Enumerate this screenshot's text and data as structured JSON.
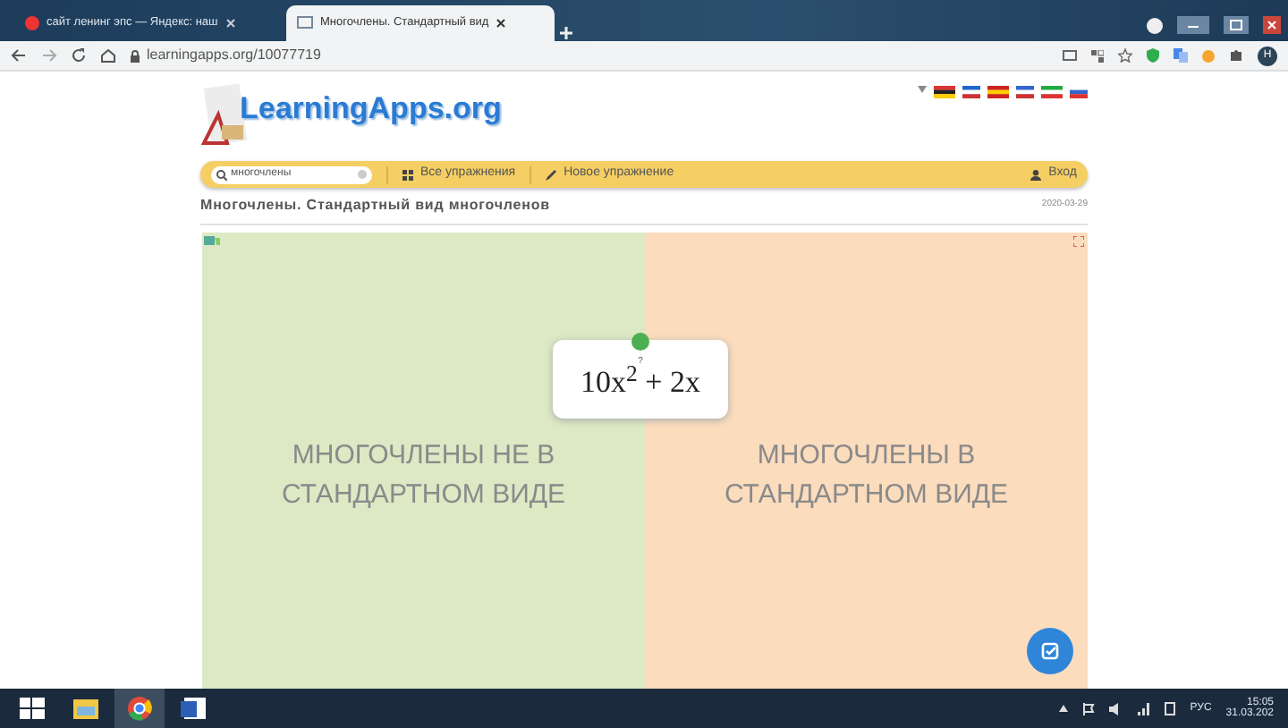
{
  "browser": {
    "tabs": [
      {
        "title": "сайт ленинг эпс — Яндекс: наш",
        "selected": false
      },
      {
        "title": "Многочлены. Стандартный вид",
        "selected": true
      }
    ],
    "url": "learningapps.org/10077719",
    "profile": "Н"
  },
  "site": {
    "logo": "LearningApps.org",
    "search": {
      "value": "многочлены"
    },
    "menu": [
      {
        "label": "Все упражнения",
        "kind": "grid"
      },
      {
        "label": "Новое упражнение",
        "kind": "pencil"
      }
    ],
    "login": "Вход"
  },
  "exercise": {
    "title": "Многочлены. Стандартный вид многочленов",
    "date": "2020-03-29",
    "groups": [
      {
        "label": "МНОГОЧЛЕНЫ НЕ В СТАНДАРТНОМ ВИДЕ",
        "color": "#dde9c4"
      },
      {
        "label": "МНОГОЧЛЕНЫ В СТАНДАРТНОМ ВИДЕ",
        "color": "#fbdcbd"
      }
    ],
    "card": {
      "hint": "?",
      "formula": "10x$^{2}$ + 2x"
    }
  },
  "taskbar": {
    "language": "РУС",
    "time": "15:05",
    "date": "31.03.202"
  }
}
